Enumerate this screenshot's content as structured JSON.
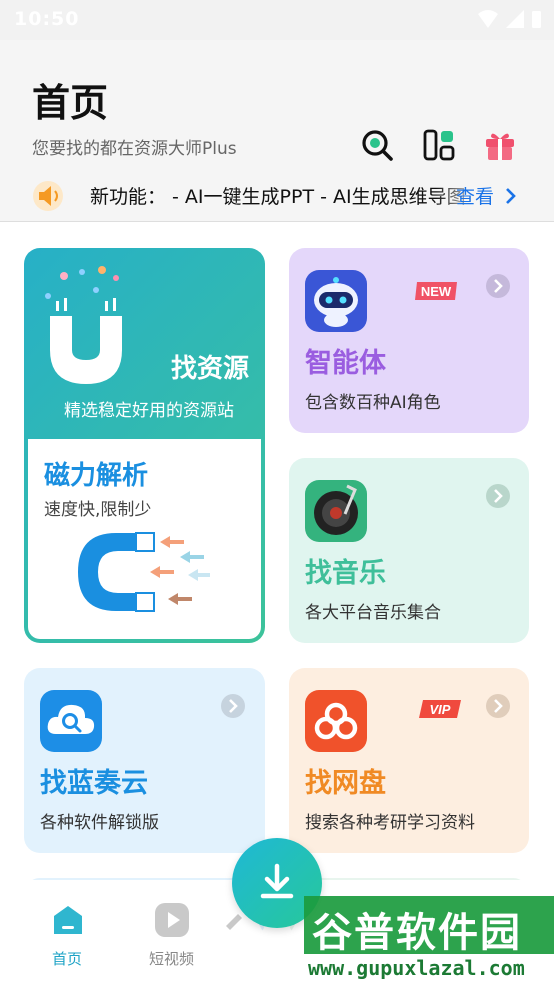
{
  "status": {
    "time": "10:50"
  },
  "header": {
    "title": "首页",
    "subtitle": "您要找的都在资源大师Plus",
    "notice": {
      "text": "新功能：  - AI一键生成PPT - AI生成思维导图",
      "more_label": "查看"
    }
  },
  "cards": {
    "find_resources": {
      "title": "找资源",
      "subtitle": "精选稳定好用的资源站",
      "magnet_title": "磁力解析",
      "magnet_subtitle": "速度快,限制少"
    },
    "agent": {
      "title": "智能体",
      "desc": "包含数百种AI角色",
      "badge": "NEW",
      "title_color": "#9a5de0"
    },
    "music": {
      "title": "找音乐",
      "desc": "各大平台音乐集合",
      "title_color": "#3fbf9a"
    },
    "lanzou": {
      "title": "找蓝奏云",
      "desc": "各种软件解锁版",
      "title_color": "#1a8fe0"
    },
    "netdisk": {
      "title": "找网盘",
      "desc": "搜索各种考研学习资料",
      "badge": "VIP",
      "title_color": "#f08a24"
    }
  },
  "nav": {
    "items": [
      {
        "label": "首页",
        "active": true,
        "icon": "home-icon"
      },
      {
        "label": "短视频",
        "active": false,
        "icon": "play-icon"
      }
    ]
  },
  "watermark": {
    "text": "谷普软件园",
    "url": "www.gupuxlazal.com"
  },
  "colors": {
    "accent": "#1a73e8",
    "teal": "#27b0c7",
    "green": "#3cc39a"
  }
}
